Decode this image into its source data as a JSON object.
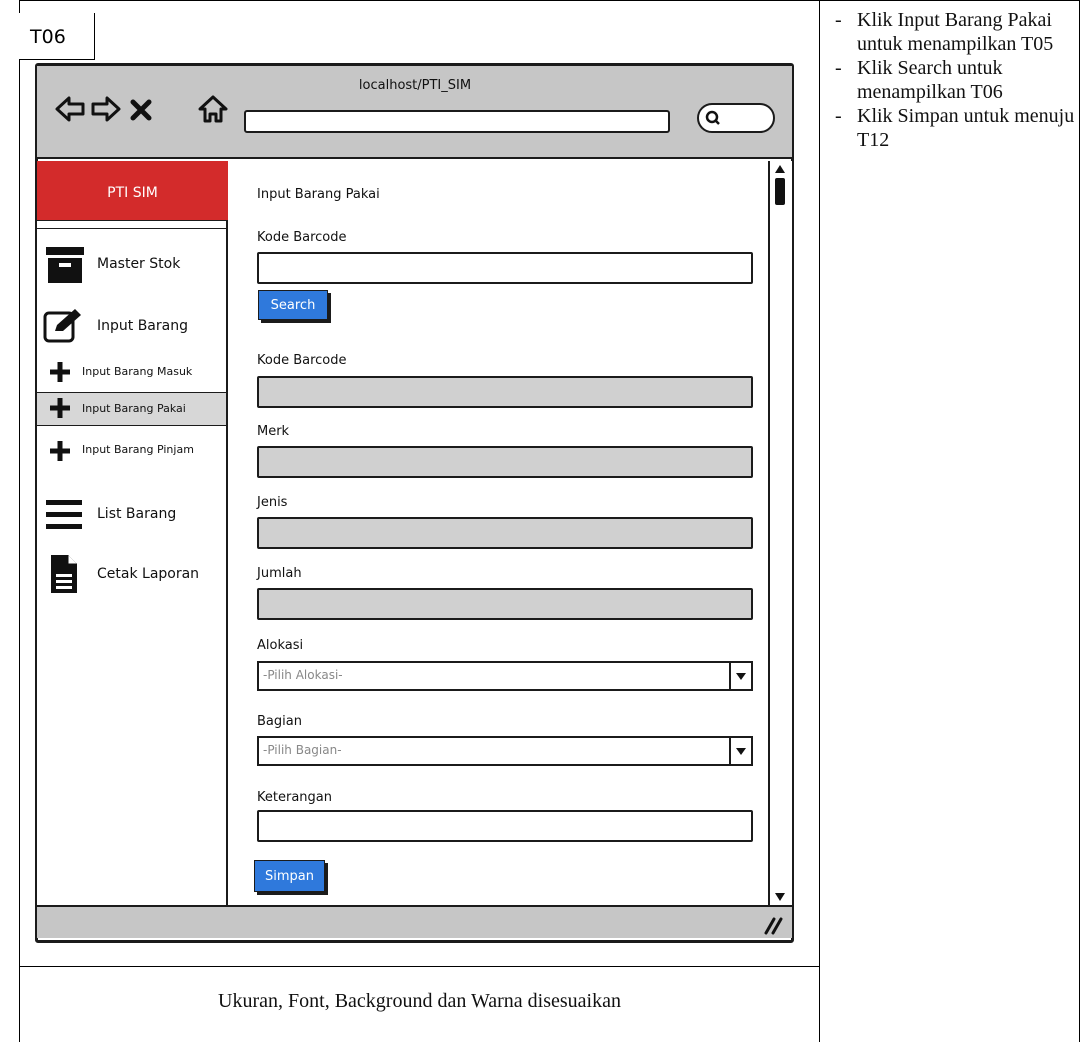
{
  "screen_id": "T06",
  "browser": {
    "url": "localhost/PTI_SIM",
    "address_value": ""
  },
  "sidebar": {
    "brand": "PTI SIM",
    "items": [
      {
        "label": "Master Stok",
        "icon": "archive-icon"
      },
      {
        "label": "Input Barang",
        "icon": "edit-icon"
      },
      {
        "label": "List Barang",
        "icon": "list-icon"
      },
      {
        "label": "Cetak Laporan",
        "icon": "document-icon"
      }
    ],
    "sub_items": [
      {
        "label": "Input Barang Masuk",
        "icon": "plus-icon"
      },
      {
        "label": "Input Barang Pakai",
        "icon": "plus-icon",
        "active": true
      },
      {
        "label": "Input Barang Pinjam",
        "icon": "plus-icon"
      }
    ]
  },
  "form": {
    "title": "Input Barang Pakai",
    "search_label": "Kode Barcode",
    "search_value": "",
    "search_button": "Search",
    "fields": [
      {
        "label": "Kode Barcode",
        "value": ""
      },
      {
        "label": "Merk",
        "value": ""
      },
      {
        "label": "Jenis",
        "value": ""
      },
      {
        "label": "Jumlah",
        "value": ""
      }
    ],
    "alokasi": {
      "label": "Alokasi",
      "placeholder": "-Pilih Alokasi-"
    },
    "bagian": {
      "label": "Bagian",
      "placeholder": "-Pilih Bagian-"
    },
    "keterangan": {
      "label": "Keterangan",
      "value": ""
    },
    "submit_button": "Simpan"
  },
  "notes": [
    "Klik Input Barang Pakai untuk menampilkan T05",
    "Klik Search untuk menampilkan T06",
    "Klik Simpan untuk menuju T12"
  ],
  "caption": "Ukuran, Font, Background dan Warna disesuaikan",
  "colors": {
    "brand": "#d32b2b",
    "button": "#2f79dc",
    "chrome": "#c6c6c6",
    "readonly": "#d0d0d0"
  }
}
